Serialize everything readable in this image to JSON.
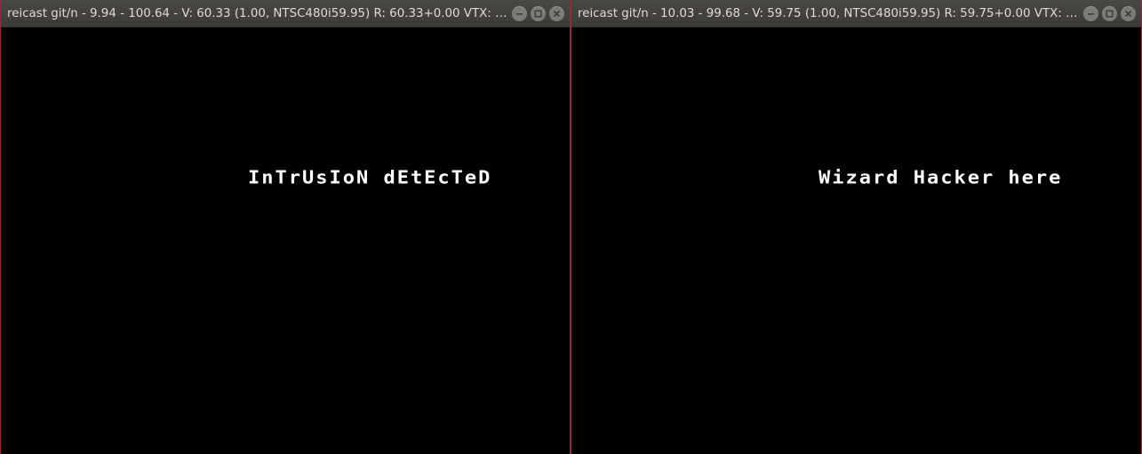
{
  "windows": [
    {
      "title": "reicast git/n - 9.94 - 100.64 - V: 60.33 (1.00, NTSC480i59.95) R: 60.33+0.00 VTX: 0....",
      "message": "InTrUsIoN dEtEcTeD",
      "controls": [
        "minimize-icon",
        "maximize-icon",
        "close-icon"
      ]
    },
    {
      "title": "reicast git/n - 10.03 - 99.68 - V: 59.75 (1.00, NTSC480i59.95) R: 59.75+0.00 VTX: 0....",
      "message": "Wizard Hacker here",
      "controls": [
        "minimize-icon",
        "maximize-icon",
        "close-icon"
      ]
    }
  ],
  "colors": {
    "titlebar": "#3c3b37",
    "title_text": "#dfdbd2",
    "window_border": "#a3233a",
    "background": "#000000",
    "message_text": "#ffffff"
  }
}
